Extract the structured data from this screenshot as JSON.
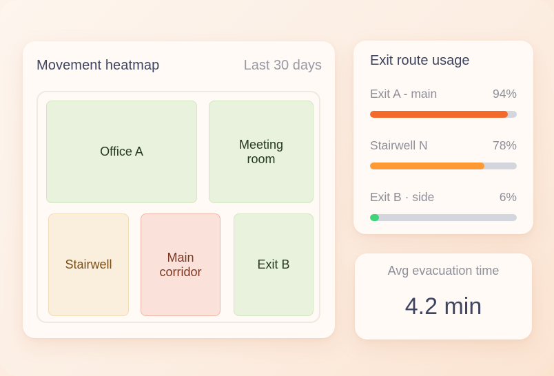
{
  "heatmap": {
    "title": "Movement heatmap",
    "range": "Last 30 days",
    "rooms": [
      {
        "label": "Office A",
        "heat": "cool"
      },
      {
        "label": "Meeting\nroom",
        "heat": "cool"
      },
      {
        "label": "Stairwell",
        "heat": "warm"
      },
      {
        "label": "Main\ncorridor",
        "heat": "hot"
      },
      {
        "label": "Exit B",
        "heat": "cool"
      }
    ],
    "colors": {
      "cool": "#e8f2dc",
      "warm": "#faefdc",
      "hot": "#fae2da"
    }
  },
  "usage": {
    "title": "Exit route usage",
    "routes": [
      {
        "label": "Exit A - main",
        "pct_label": "94%",
        "value": 0.94,
        "color": "#f26a2c"
      },
      {
        "label": "Stairwell N",
        "pct_label": "78%",
        "value": 0.78,
        "color": "#fd9a33"
      },
      {
        "label": "Exit B · side",
        "pct_label": "6%",
        "value": 0.06,
        "color": "#3dd47a"
      }
    ]
  },
  "avg": {
    "label": "Avg evacuation time",
    "value": "4.2 min"
  }
}
